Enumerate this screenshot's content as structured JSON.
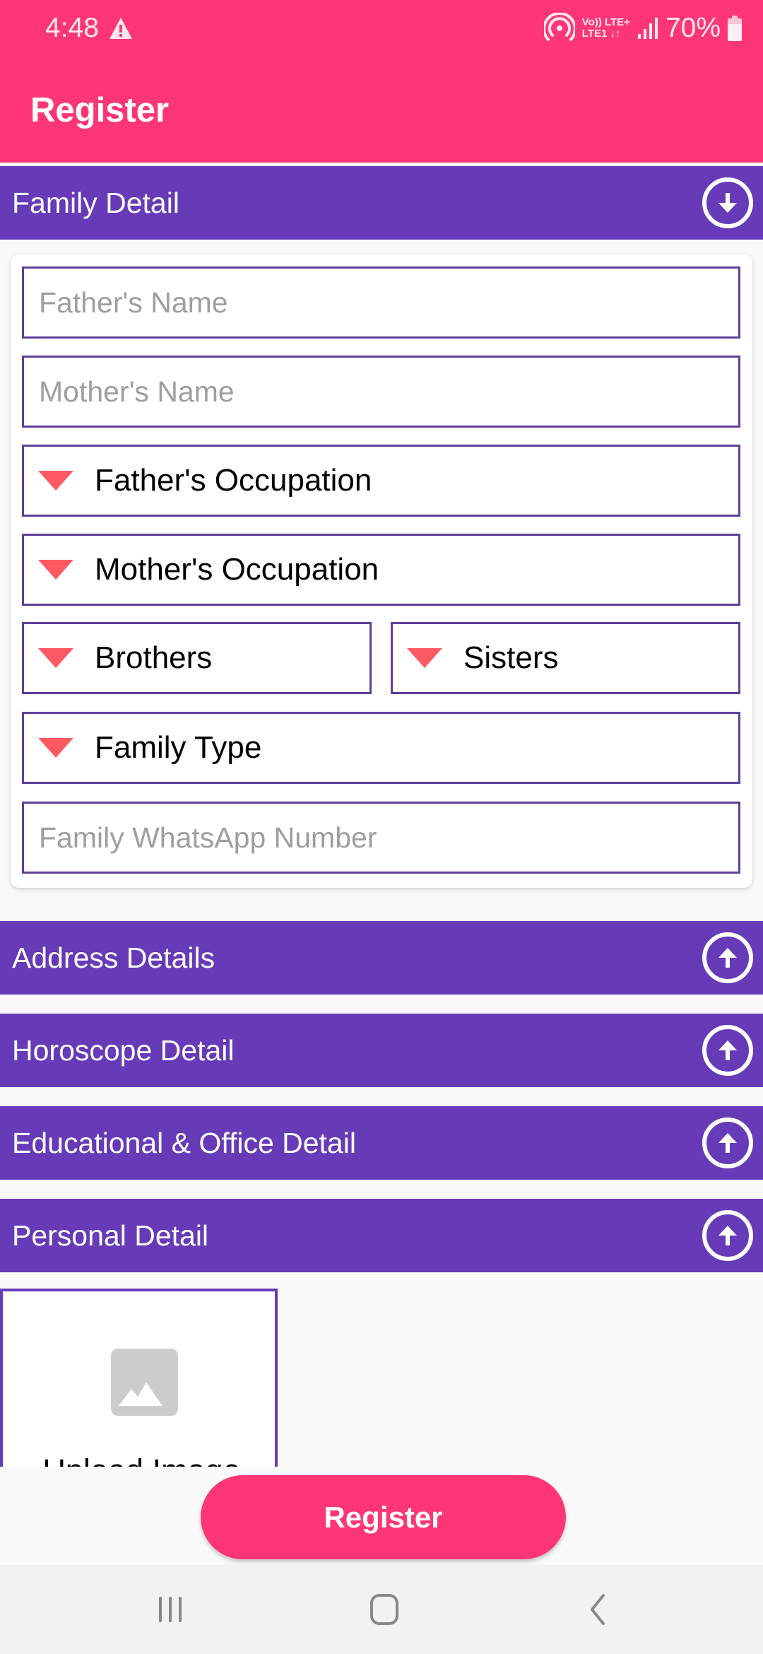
{
  "status_bar": {
    "time": "4:48",
    "network_top": "Vo)) LTE+",
    "network_bottom": "LTE1",
    "network_arrows": "↓↑",
    "battery": "70%",
    "icons": [
      "warning-icon",
      "hotspot-icon",
      "signal-icon",
      "battery-icon"
    ]
  },
  "app_bar": {
    "title": "Register"
  },
  "family_detail": {
    "title": "Family Detail",
    "toggle_icon": "arrow-down-circle-icon",
    "fields": {
      "fathers_name": {
        "placeholder": "Father's Name",
        "value": ""
      },
      "mothers_name": {
        "placeholder": "Mother's Name",
        "value": ""
      },
      "fathers_occupation": {
        "label": "Father's Occupation"
      },
      "mothers_occupation": {
        "label": "Mother's Occupation"
      },
      "brothers": {
        "label": "Brothers"
      },
      "sisters": {
        "label": "Sisters"
      },
      "family_type": {
        "label": "Family Type"
      },
      "family_whatsapp": {
        "placeholder": "Family WhatsApp Number",
        "value": ""
      }
    }
  },
  "sections": [
    {
      "title": "Address Details",
      "toggle_icon": "arrow-up-circle-icon"
    },
    {
      "title": "Horoscope Detail",
      "toggle_icon": "arrow-up-circle-icon"
    },
    {
      "title": "Educational & Office Detail",
      "toggle_icon": "arrow-up-circle-icon"
    },
    {
      "title": "Personal Detail",
      "toggle_icon": "arrow-up-circle-icon"
    }
  ],
  "upload": {
    "label": "Upload Image",
    "icon": "image-placeholder-icon"
  },
  "register_button": {
    "label": "Register"
  },
  "nav_bar": {
    "recents": "recents-icon",
    "home": "home-icon",
    "back": "back-icon"
  },
  "colors": {
    "primary_pink": "#ff3675",
    "section_purple": "#673ab7",
    "field_border": "#5e3f9a",
    "dropdown_arrow": "#ff5a62",
    "placeholder_gray": "#9e9e9e"
  }
}
